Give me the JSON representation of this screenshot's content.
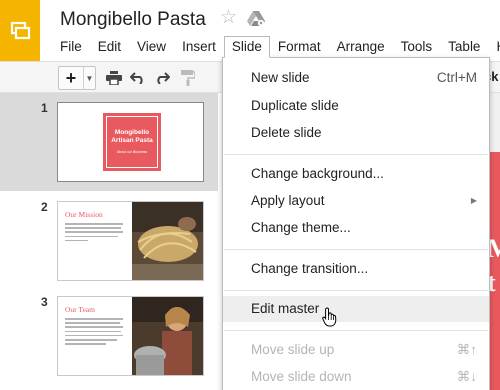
{
  "app": {
    "title": "Mongibello Pasta",
    "logo_icon": "slides-logo-icon",
    "star_icon": "star-icon",
    "drive_icon": "drive-icon"
  },
  "menubar": [
    {
      "label": "File"
    },
    {
      "label": "Edit"
    },
    {
      "label": "View"
    },
    {
      "label": "Insert"
    },
    {
      "label": "Slide",
      "active": true
    },
    {
      "label": "Format"
    },
    {
      "label": "Arrange"
    },
    {
      "label": "Tools"
    },
    {
      "label": "Table"
    },
    {
      "label": "He"
    }
  ],
  "toolbar": {
    "new_label": "+",
    "cut_off_text": "ck",
    "icons": [
      "new-slide-icon",
      "print-icon",
      "undo-icon",
      "redo-icon",
      "paint-format-icon"
    ]
  },
  "slides": [
    {
      "number": "1",
      "card_title": "Mongibello Artisan Pasta",
      "card_sub": "About our Business"
    },
    {
      "number": "2",
      "title": "Our Mission"
    },
    {
      "number": "3",
      "title": "Our Team"
    }
  ],
  "canvas": {
    "letters": "M\nt"
  },
  "slide_menu": {
    "items": [
      {
        "label": "New slide",
        "shortcut": "Ctrl+M"
      },
      {
        "label": "Duplicate slide"
      },
      {
        "label": "Delete slide"
      },
      {
        "label": "Change background..."
      },
      {
        "label": "Apply layout",
        "submenu": true
      },
      {
        "label": "Change theme..."
      },
      {
        "label": "Change transition..."
      },
      {
        "label": "Edit master",
        "hovered": true
      },
      {
        "label": "Move slide up",
        "shortcut": "⌘↑",
        "disabled": true
      },
      {
        "label": "Move slide down",
        "shortcut": "⌘↓",
        "disabled": true
      }
    ]
  },
  "colors": {
    "logo_yellow": "#f4b400",
    "accent_red": "#e85a5f"
  }
}
